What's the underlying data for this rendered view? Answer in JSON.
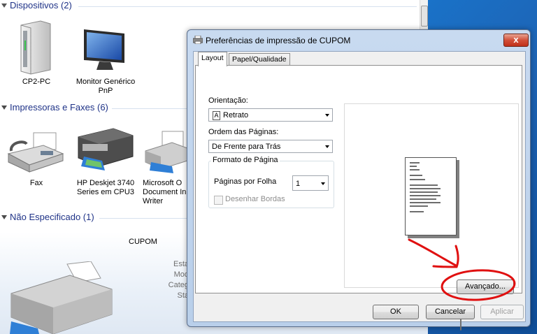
{
  "explorer": {
    "groups": {
      "devices": "Dispositivos (2)",
      "printers": "Impressoras e Faxes (6)",
      "unspecified": "Não Especificado (1)"
    },
    "devices": [
      {
        "label": "CP2-PC"
      },
      {
        "label": "Monitor Genérico\nPnP"
      }
    ],
    "printers": [
      {
        "label": "Fax"
      },
      {
        "label": "HP Deskjet 3740\nSeries em CPU3"
      },
      {
        "label": "Microsoft O\nDocument In\nWriter"
      }
    ],
    "details": {
      "name": "CUPOM",
      "labels": [
        "Esta",
        "Mod",
        "Categ",
        "Sta"
      ]
    }
  },
  "dialog": {
    "title": "Preferências de impressão de CUPOM",
    "close_glyph": "x",
    "tabs": [
      "Layout",
      "Papel/Qualidade"
    ],
    "orientation": {
      "label": "Orientação:",
      "value": "Retrato",
      "icon_letter": "A"
    },
    "page_order": {
      "label": "Ordem das Páginas:",
      "value": "De Frente para Trás"
    },
    "page_format": {
      "legend": "Formato de Página",
      "pages_per_sheet_label": "Páginas por Folha",
      "pages_per_sheet_value": "1",
      "draw_borders_label": "Desenhar Bordas",
      "draw_borders_checked": false
    },
    "advanced_button": "Avançado...",
    "ok_button": "OK",
    "cancel_button": "Cancelar",
    "apply_button": "Aplicar"
  },
  "colors": {
    "group_header": "#1e3287",
    "annotation": "#e01010",
    "desktop": "#1a6cc0"
  },
  "icons": {
    "computer": "cp2-pc-tower-icon",
    "monitor": "monitor-icon",
    "fax": "fax-icon",
    "printer": "printer-icon"
  }
}
